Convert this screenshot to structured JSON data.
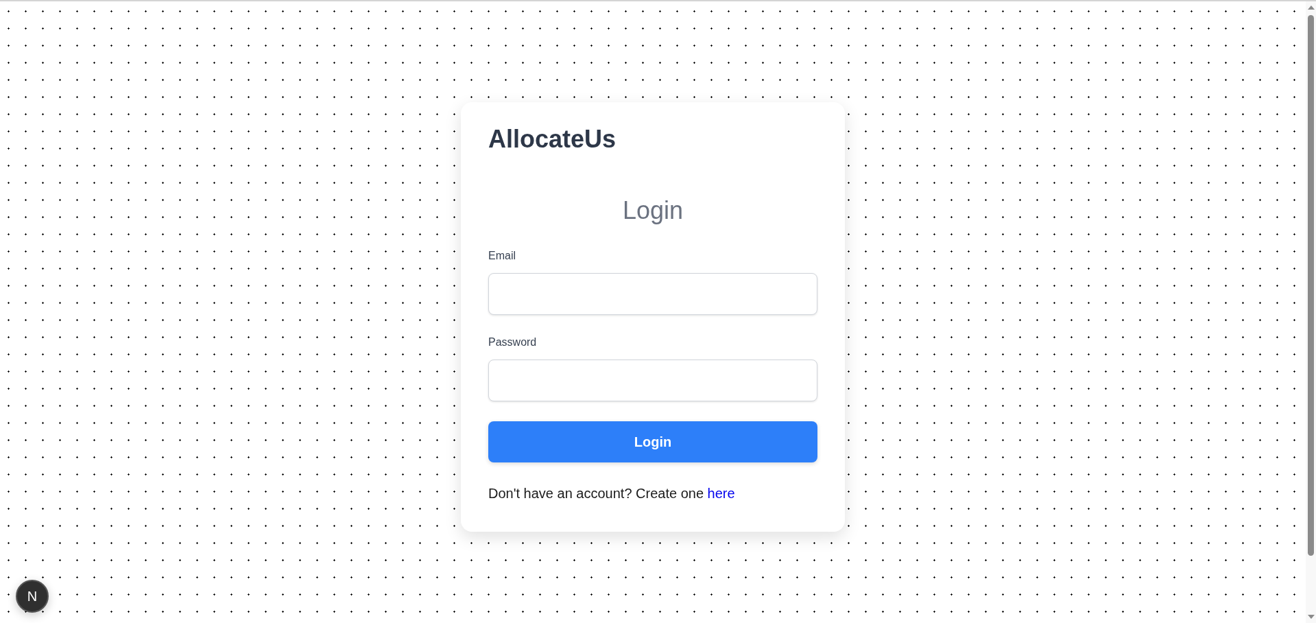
{
  "brand": "AllocateUs",
  "heading": "Login",
  "fields": [
    {
      "label": "Email"
    },
    {
      "label": "Password"
    }
  ],
  "submit": "Login",
  "footer": {
    "text": "Don't have an account? Create one",
    "link": "here"
  },
  "dev_badge": "N"
}
